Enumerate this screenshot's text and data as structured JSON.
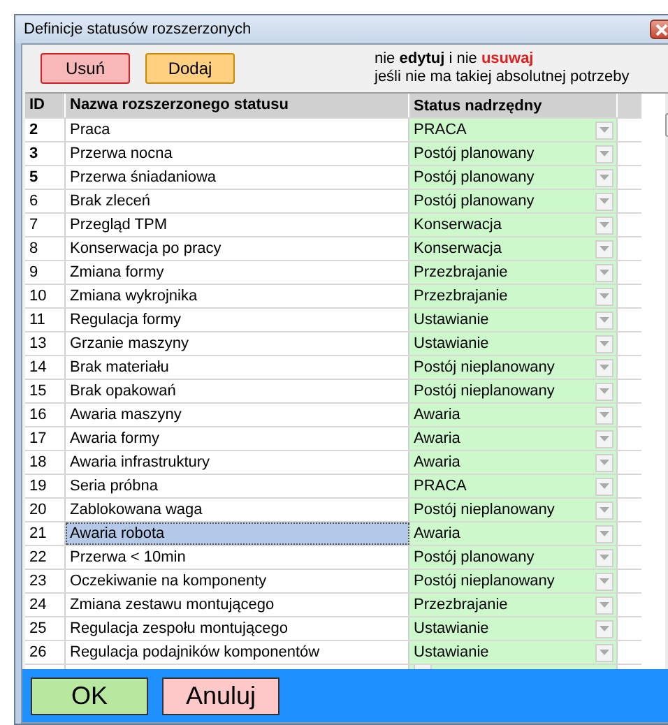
{
  "window": {
    "title": "Definicje statusów rozszerzonych"
  },
  "toolbar": {
    "buttons": [
      {
        "label": "Usuń",
        "kind": "danger"
      },
      {
        "label": "Dodaj",
        "kind": "add"
      }
    ],
    "warning": [
      [
        {
          "text": "nie ",
          "kind": "plain"
        },
        {
          "text": "edytuj",
          "kind": "bold"
        },
        {
          "text": " i nie ",
          "kind": "plain"
        },
        {
          "text": "usuwaj",
          "kind": "alert"
        }
      ],
      [
        {
          "text": "jeśli nie ma takiej absolutnej potrzeby",
          "kind": "plain"
        }
      ]
    ]
  },
  "table": {
    "columns": [
      "ID",
      "Nazwa rozszerzonego statusu",
      "Status nadrzędny"
    ],
    "rows": [
      {
        "id": "2",
        "name": "Praca",
        "status": "PRACA",
        "bold": true,
        "selected": false
      },
      {
        "id": "3",
        "name": "Przerwa nocna",
        "status": "Postój planowany",
        "bold": true,
        "selected": false
      },
      {
        "id": "5",
        "name": "Przerwa śniadaniowa",
        "status": "Postój planowany",
        "bold": true,
        "selected": false
      },
      {
        "id": "6",
        "name": "Brak zleceń",
        "status": "Postój planowany",
        "bold": false,
        "selected": false
      },
      {
        "id": "7",
        "name": "Przegląd TPM",
        "status": "Konserwacja",
        "bold": false,
        "selected": false
      },
      {
        "id": "8",
        "name": "Konserwacja po pracy",
        "status": "Konserwacja",
        "bold": false,
        "selected": false
      },
      {
        "id": "9",
        "name": "Zmiana formy",
        "status": "Przezbrajanie",
        "bold": false,
        "selected": false
      },
      {
        "id": "10",
        "name": "Zmiana wykrojnika",
        "status": "Przezbrajanie",
        "bold": false,
        "selected": false
      },
      {
        "id": "11",
        "name": "Regulacja formy",
        "status": "Ustawianie",
        "bold": false,
        "selected": false
      },
      {
        "id": "13",
        "name": "Grzanie maszyny",
        "status": "Ustawianie",
        "bold": false,
        "selected": false
      },
      {
        "id": "14",
        "name": "Brak materiału",
        "status": "Postój nieplanowany",
        "bold": false,
        "selected": false
      },
      {
        "id": "15",
        "name": "Brak opakowań",
        "status": "Postój nieplanowany",
        "bold": false,
        "selected": false
      },
      {
        "id": "16",
        "name": "Awaria maszyny",
        "status": "Awaria",
        "bold": false,
        "selected": false
      },
      {
        "id": "17",
        "name": "Awaria formy",
        "status": "Awaria",
        "bold": false,
        "selected": false
      },
      {
        "id": "18",
        "name": "Awaria infrastruktury",
        "status": "Awaria",
        "bold": false,
        "selected": false
      },
      {
        "id": "19",
        "name": "Seria próbna",
        "status": "PRACA",
        "bold": false,
        "selected": false
      },
      {
        "id": "20",
        "name": "Zablokowana waga",
        "status": "Postój nieplanowany",
        "bold": false,
        "selected": false
      },
      {
        "id": "21",
        "name": "Awaria robota",
        "status": "Awaria",
        "bold": false,
        "selected": true
      },
      {
        "id": "22",
        "name": "Przerwa < 10min",
        "status": "Postój planowany",
        "bold": false,
        "selected": false
      },
      {
        "id": "23",
        "name": "Oczekiwanie na komponenty",
        "status": "Postój nieplanowany",
        "bold": false,
        "selected": false
      },
      {
        "id": "24",
        "name": "Zmiana zestawu montującego",
        "status": "Przezbrajanie",
        "bold": false,
        "selected": false
      },
      {
        "id": "25",
        "name": "Regulacja zespołu montującego",
        "status": "Ustawianie",
        "bold": false,
        "selected": false
      },
      {
        "id": "26",
        "name": "Regulacja podajników komponentów",
        "status": "Ustawianie",
        "bold": false,
        "selected": false
      }
    ]
  },
  "footer": {
    "buttons": [
      {
        "label": "OK",
        "kind": "ok"
      },
      {
        "label": "Anuluj",
        "kind": "cancel"
      }
    ]
  }
}
